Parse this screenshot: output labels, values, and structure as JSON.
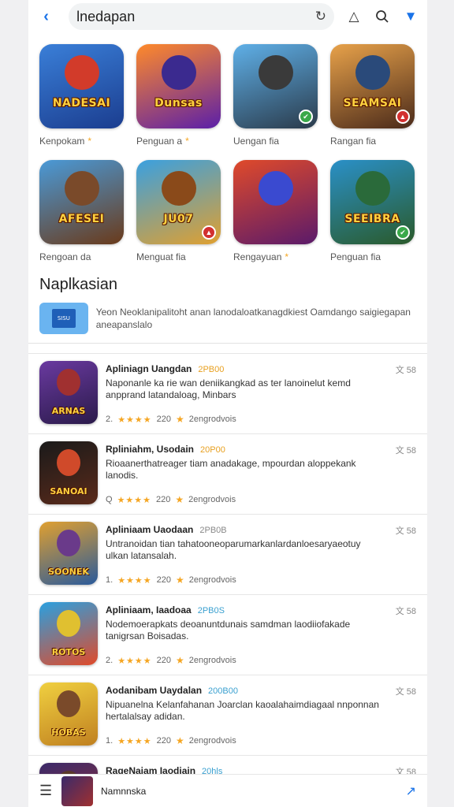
{
  "topbar": {
    "search_text": "lnedapan"
  },
  "grid": {
    "row1": [
      {
        "art_text": "NADESAI",
        "caption": "Kenpokam",
        "star": true,
        "badge": "",
        "bg": "linear-gradient(160deg,#3a7fd8,#1b3d8f)",
        "fig": "#d23b2a",
        "badge_color": ""
      },
      {
        "art_text": "Dunsas",
        "caption": "Penguan a",
        "star": true,
        "badge": "",
        "bg": "linear-gradient(160deg,#ff8a2a,#5b1fa8)",
        "fig": "#3b2a8f",
        "badge_color": ""
      },
      {
        "art_text": "",
        "caption": "Uengan fia",
        "star": false,
        "badge": "✔",
        "bg": "linear-gradient(160deg,#5fb0e8,#2a3a4a)",
        "fig": "#3a3a3a",
        "badge_color": "#3aa84a"
      },
      {
        "art_text": "SEAMSAI",
        "caption": "Rangan fia",
        "star": false,
        "badge": "▲",
        "bg": "linear-gradient(160deg,#e8a24a,#4a2a1a)",
        "fig": "#2a4a7a",
        "badge_color": "#d23030"
      }
    ],
    "row2": [
      {
        "art_text": "AFESEI",
        "caption": "Rengoan da",
        "star": false,
        "badge": "",
        "bg": "linear-gradient(160deg,#4a9ad8,#6a3a1a)",
        "fig": "#7a4a2a",
        "badge_color": ""
      },
      {
        "art_text": "JU07",
        "caption": "Menguat fia",
        "star": false,
        "badge": "▲",
        "bg": "linear-gradient(160deg,#3aa0e0,#e0a030)",
        "fig": "#8a4a1a",
        "badge_color": "#d23030"
      },
      {
        "art_text": "",
        "caption": "Rengayuan",
        "star": true,
        "badge": "",
        "bg": "linear-gradient(160deg,#e04a2a,#5a1a6a)",
        "fig": "#3a4ad0",
        "badge_color": ""
      },
      {
        "art_text": "SEEIBRA",
        "caption": "Penguan fia",
        "star": false,
        "badge": "✔",
        "bg": "linear-gradient(160deg,#2a90c8,#2a5a2a)",
        "fig": "#2a6a3a",
        "badge_color": "#3aa84a"
      }
    ]
  },
  "section": {
    "title": "Naplkasian",
    "banner_thumb_text": "SISU",
    "banner_text": "Yeon Neoklanipalitoht anan lanodaloatkanagdkiest Oamdango saigiegapan aneapanslalo"
  },
  "list": [
    {
      "title": "Apliniagn Uangdan",
      "tag": "2PB00",
      "tag_color": "#e8a020",
      "desc": "Naponanle ka rie wan deniikangkad as ter lanoinelut kemd anpprand latandaloag, Minbars",
      "num": "2.",
      "score": "220",
      "rating": "2engrodvois",
      "side": "文 58",
      "art": "ARNAS",
      "bg": "linear-gradient(160deg,#6a3aa0,#2a1a4a)",
      "fig": "#a03030"
    },
    {
      "title": "Rpliniahm, Usodain",
      "tag": "20P00",
      "tag_color": "#e8a020",
      "desc": "Rioaanerthatreager tiam anadakage, mpourdan aloppekank lanodis.",
      "num": "Q",
      "score": "220",
      "rating": "2engrodvois",
      "side": "文 58",
      "art": "SANOAI",
      "bg": "linear-gradient(160deg,#1a1a1a,#5a2a1a)",
      "fig": "#d04a2a"
    },
    {
      "title": "Apliniaam Uaodaan",
      "tag": "2PB0B",
      "tag_color": "#888888",
      "desc": "Untranoidan tian tahatooneoparumarkanlardanloesaryaeotuy ulkan latansalah.",
      "num": "1.",
      "score": "220",
      "rating": "2engrodvois",
      "side": "文 58",
      "art": "SOONEK",
      "bg": "linear-gradient(160deg,#e0a030,#2a5a9a)",
      "fig": "#6a3a8a"
    },
    {
      "title": "Apliniaam, Iaadoaa",
      "tag": "2PB0S",
      "tag_color": "#3aa0d0",
      "desc": "Nodemoerapkats deoanuntdunais samdman laodiiofakade tanigrsan Boisadas.",
      "num": "2.",
      "score": "220",
      "rating": "2engrodvois",
      "side": "文 58",
      "art": "ROTOS",
      "bg": "linear-gradient(160deg,#2aa0e0,#e04a2a)",
      "fig": "#e0c030"
    },
    {
      "title": "Aodanibam Uaydalan",
      "tag": "200B00",
      "tag_color": "#3aa0d0",
      "desc": "Nipuanelna Kelanfahanan Joarclan kaoalahaimdiagaal nnponnan hertalalsay adidan.",
      "num": "1.",
      "score": "220",
      "rating": "2engrodvois",
      "side": "文 58",
      "art": "HOBAS",
      "bg": "linear-gradient(160deg,#f0d040,#c08020)",
      "fig": "#7a4a2a"
    },
    {
      "title": "RageNaiam Iaodiain",
      "tag": "20hls",
      "tag_color": "#3aa0d0",
      "desc": "",
      "num": "",
      "score": "",
      "rating": "",
      "side": "文 58",
      "art": "",
      "bg": "linear-gradient(160deg,#3a2a6a,#a03030)",
      "fig": "#5a3a2a"
    }
  ],
  "bottombar": {
    "label": "Namnnska"
  },
  "colors": {
    "accent": "#1a73e8",
    "star": "#f5a623"
  }
}
